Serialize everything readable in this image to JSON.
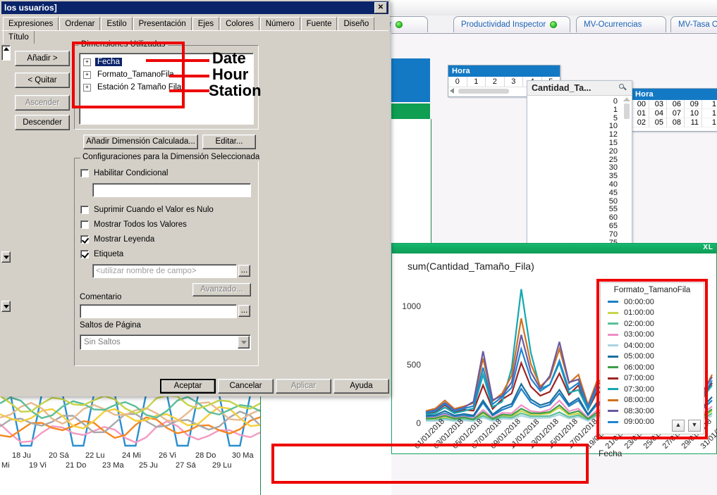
{
  "background_app": {
    "tabs": [
      {
        "label": "dador",
        "dot": true
      },
      {
        "label": "Productividad Inspector",
        "dot": true
      },
      {
        "label": "MV-Ocurrencias",
        "dot": false
      },
      {
        "label": "MV-Tasa Ocurren",
        "dot": false
      }
    ],
    "hora_listbox": {
      "title": "Hora",
      "values": [
        "0",
        "1",
        "2",
        "3",
        "4",
        "5"
      ]
    },
    "hora_grid": {
      "title": "Hora",
      "rows": [
        [
          "00",
          "03",
          "06",
          "09",
          "1"
        ],
        [
          "01",
          "04",
          "07",
          "10",
          "1"
        ],
        [
          "02",
          "05",
          "08",
          "11",
          "1"
        ]
      ]
    },
    "cantidad_panel": {
      "title": "Cantidad_Ta...",
      "search_icon": "magnifier-icon",
      "values": [
        "0",
        "1",
        "5",
        "10",
        "12",
        "15",
        "20",
        "25",
        "30",
        "35",
        "40",
        "45",
        "50",
        "55",
        "60",
        "65",
        "70",
        "75"
      ]
    }
  },
  "chart_data": {
    "type": "line",
    "title": "sum(Cantidad_Tamaño_Fila)",
    "xlabel": "Fecha",
    "ylabel": "",
    "ylim": [
      0,
      1250
    ],
    "yticks": [
      0,
      500,
      1000
    ],
    "ytick_labels": [
      "0",
      "500",
      "1000"
    ],
    "grid": false,
    "legend_position": "right",
    "legend_title": "Formato_TamanoFila",
    "x": [
      "01/01/2018",
      "03/01/2018",
      "05/01/2018",
      "07/01/2018",
      "09/01/2018",
      "11/01/2018",
      "13/01/2018",
      "15/01/2018",
      "17/01/2018",
      "19/01/2018",
      "21/01/2018",
      "23/01/2018",
      "25/01/2018",
      "27/01/2018",
      "29/01/2018",
      "31/01/2018"
    ],
    "series": [
      {
        "name": "00:00:00",
        "color": "#1f7fc4",
        "values": [
          60,
          90,
          70,
          180,
          120,
          300,
          140,
          260,
          200,
          170,
          320,
          150,
          230,
          180,
          420,
          200
        ]
      },
      {
        "name": "01:00:00",
        "color": "#c8d44a",
        "values": [
          40,
          60,
          55,
          90,
          70,
          110,
          80,
          140,
          90,
          100,
          150,
          80,
          120,
          95,
          180,
          110
        ]
      },
      {
        "name": "02:00:00",
        "color": "#5bbf9a",
        "values": [
          30,
          45,
          40,
          70,
          60,
          90,
          65,
          100,
          75,
          80,
          110,
          70,
          95,
          85,
          130,
          90
        ]
      },
      {
        "name": "03:00:00",
        "color": "#ef8fc8",
        "values": [
          50,
          80,
          60,
          120,
          95,
          160,
          100,
          200,
          130,
          120,
          210,
          110,
          170,
          140,
          260,
          150
        ]
      },
      {
        "name": "04:00:00",
        "color": "#aad4e0",
        "values": [
          25,
          35,
          30,
          55,
          45,
          70,
          50,
          80,
          60,
          65,
          85,
          55,
          75,
          65,
          100,
          70
        ]
      },
      {
        "name": "05:00:00",
        "color": "#1a6fa0",
        "values": [
          70,
          110,
          85,
          200,
          140,
          340,
          160,
          290,
          220,
          190,
          360,
          170,
          260,
          210,
          470,
          230
        ]
      },
      {
        "name": "06:00:00",
        "color": "#3f9e48",
        "values": [
          45,
          70,
          55,
          100,
          80,
          130,
          90,
          160,
          110,
          100,
          170,
          95,
          140,
          115,
          200,
          125
        ]
      },
      {
        "name": "07:00:00",
        "color": "#9e2424",
        "values": [
          90,
          160,
          120,
          330,
          210,
          520,
          240,
          430,
          330,
          280,
          540,
          250,
          400,
          320,
          700,
          350
        ]
      },
      {
        "name": "07:30:00",
        "color": "#14a8b0",
        "values": [
          80,
          140,
          110,
          420,
          190,
          1150,
          300,
          520,
          290,
          320,
          620,
          240,
          480,
          300,
          760,
          330
        ]
      },
      {
        "name": "08:00:00",
        "color": "#cf7320",
        "values": [
          110,
          200,
          150,
          560,
          260,
          900,
          320,
          640,
          420,
          380,
          720,
          310,
          520,
          400,
          880,
          420
        ]
      },
      {
        "name": "08:30:00",
        "color": "#6a5aa0",
        "values": [
          100,
          180,
          140,
          620,
          240,
          760,
          300,
          700,
          380,
          350,
          800,
          290,
          560,
          380,
          940,
          400
        ]
      },
      {
        "name": "09:00:00",
        "color": "#1f86d0",
        "values": [
          95,
          170,
          130,
          480,
          230,
          640,
          280,
          540,
          350,
          320,
          660,
          270,
          470,
          340,
          820,
          370
        ]
      }
    ],
    "legend_entries": [
      {
        "label": "00:00:00",
        "color": "#1f7fc4"
      },
      {
        "label": "01:00:00",
        "color": "#c8d44a"
      },
      {
        "label": "02:00:00",
        "color": "#5bbf9a"
      },
      {
        "label": "03:00:00",
        "color": "#ef8fc8"
      },
      {
        "label": "04:00:00",
        "color": "#aad4e0"
      },
      {
        "label": "05:00:00",
        "color": "#1a6fa0"
      },
      {
        "label": "06:00:00",
        "color": "#3f9e48"
      },
      {
        "label": "07:00:00",
        "color": "#9e2424"
      },
      {
        "label": "07:30:00",
        "color": "#14a8b0"
      },
      {
        "label": "08:00:00",
        "color": "#cf7320"
      },
      {
        "label": "08:30:00",
        "color": "#6a5aa0"
      },
      {
        "label": "09:00:00",
        "color": "#1f86d0"
      }
    ],
    "excel_export_label": "XL"
  },
  "bottom_left_chart": {
    "type": "line",
    "x_labels_top": [
      "18 Ju",
      "20 Sá",
      "22 Lu",
      "24 Mi",
      "26 Vi",
      "28 Do",
      "30 Ma"
    ],
    "x_labels_bottom": [
      "Mi",
      "19 Vi",
      "21 Do",
      "23 Ma",
      "25 Ju",
      "27 Sá",
      "29 Lu"
    ],
    "series_colors": [
      "#2b8fd0",
      "#f49ac1",
      "#f5871f",
      "#a8a8a8",
      "#f4cf3a",
      "#e8b98e",
      "#5bbf9a",
      "#c8d44a"
    ]
  },
  "dialog": {
    "title": "los usuarios]",
    "close_label": "✕",
    "tabs": [
      "Expresiones",
      "Ordenar",
      "Estilo",
      "Presentación",
      "Ejes",
      "Colores",
      "Número",
      "Fuente",
      "Diseño",
      "Título"
    ],
    "side_buttons": [
      {
        "label": "Añadir >",
        "disabled": false
      },
      {
        "label": "< Quitar",
        "disabled": false
      },
      {
        "label": "Ascender",
        "disabled": true
      },
      {
        "label": "Descender",
        "disabled": false
      }
    ],
    "dimensions_group": {
      "label": "Dimensiones Utilizadas",
      "items": [
        {
          "label": "Fecha",
          "selected": true,
          "expander": "+"
        },
        {
          "label": "Formato_TamanoFila",
          "selected": false,
          "expander": "+"
        },
        {
          "label": "Estación 2 Tamaño Fila",
          "selected": false,
          "expander": "+"
        }
      ]
    },
    "dimension_buttons": [
      {
        "label": "Añadir Dimensión Calculada...",
        "disabled": false
      },
      {
        "label": "Editar...",
        "disabled": false
      }
    ],
    "settings_group": {
      "label": "Configuraciones para la Dimensión Seleccionada",
      "conditional": {
        "label": "Habilitar Condicional",
        "checked": false,
        "value": ""
      },
      "checkboxes": [
        {
          "label": "Suprimir Cuando el Valor es Nulo",
          "checked": false
        },
        {
          "label": "Mostrar Todos los Valores",
          "checked": false
        },
        {
          "label": "Mostrar Leyenda",
          "checked": true
        },
        {
          "label": "Etiqueta",
          "checked": true
        }
      ],
      "label_field": {
        "placeholder": "<utilizar nombre de campo>",
        "value": "",
        "ellipsis": "..."
      },
      "advanced_button": {
        "label": "Avanzado...",
        "disabled": true
      },
      "comment": {
        "label": "Comentario",
        "value": "",
        "ellipsis": "..."
      },
      "page_breaks": {
        "label": "Saltos de Página",
        "value": "Sin Saltos"
      }
    },
    "footer_buttons": [
      {
        "label": "Aceptar",
        "disabled": false,
        "default": true
      },
      {
        "label": "Cancelar",
        "disabled": false,
        "default": false
      },
      {
        "label": "Aplicar",
        "disabled": true,
        "default": false
      },
      {
        "label": "Ayuda",
        "disabled": false,
        "default": false
      }
    ]
  },
  "annotations": {
    "date": "Date",
    "hour": "Hour",
    "station": "Station",
    "highlight_color": "#ee0000"
  }
}
